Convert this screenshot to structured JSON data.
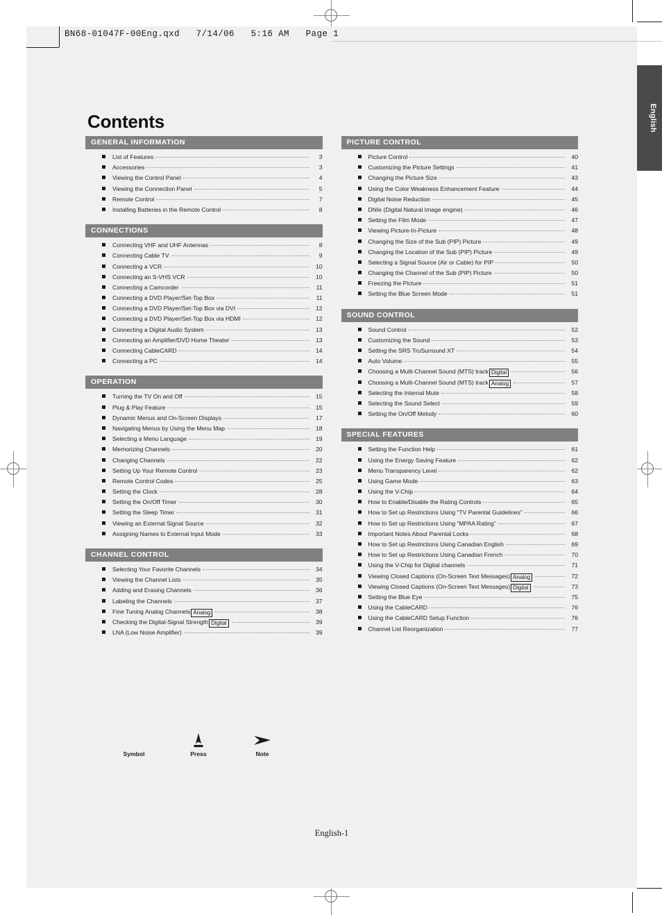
{
  "file_header": "BN68-01047F-00Eng.qxd   7/14/06   5:16 AM   Page 1",
  "lang_tab": "English",
  "page_title": "Contents",
  "footer": "English-1",
  "legend": {
    "symbol_label": "Symbol",
    "press_label": "Press",
    "note_label": "Note"
  },
  "columns": [
    {
      "sections": [
        {
          "header": "GENERAL INFORMATION",
          "items": [
            {
              "label": "List of Features",
              "page": "3"
            },
            {
              "label": "Accessories",
              "page": "3"
            },
            {
              "label": "Viewing the Control Panel",
              "page": "4"
            },
            {
              "label": "Viewing the Connection Panel",
              "page": "5"
            },
            {
              "label": "Remote Control",
              "page": "7"
            },
            {
              "label": "Installing Batteries in the Remote Control",
              "page": "8"
            }
          ]
        },
        {
          "header": "CONNECTIONS",
          "items": [
            {
              "label": "Connecting VHF and UHF Antennas",
              "page": "8"
            },
            {
              "label": "Connecting Cable TV",
              "page": "9"
            },
            {
              "label": "Connecting a VCR",
              "page": "10"
            },
            {
              "label": "Connecting an S-VHS VCR",
              "page": "10"
            },
            {
              "label": "Connecting a Camcorder",
              "page": "11"
            },
            {
              "label": "Connecting a DVD Player/Set-Top Box",
              "page": "11"
            },
            {
              "label": "Connecting a DVD Player/Set-Top Box via DVI",
              "page": "12"
            },
            {
              "label": "Connecting a DVD Player/Set-Top Box via HDMI",
              "page": "12"
            },
            {
              "label": "Connecting a Digital Audio System",
              "page": "13"
            },
            {
              "label": "Connecting an Amplifier/DVD Home Theater",
              "page": "13"
            },
            {
              "label": "Connecting CableCARD",
              "page": "14"
            },
            {
              "label": "Connecting a PC",
              "page": "14"
            }
          ]
        },
        {
          "header": "OPERATION",
          "items": [
            {
              "label": "Turning the TV On and Off",
              "page": "15"
            },
            {
              "label": "Plug & Play Feature",
              "page": "15"
            },
            {
              "label": "Dynamic Menus and On-Screen Displays",
              "page": "17"
            },
            {
              "label": "Navigating Menus by Using the Menu Map",
              "page": "18"
            },
            {
              "label": "Selecting a Menu Language",
              "page": "19"
            },
            {
              "label": "Memorizing Channels",
              "page": "20"
            },
            {
              "label": "Changing Channels",
              "page": "22"
            },
            {
              "label": "Setting Up Your Remote Control",
              "page": "23"
            },
            {
              "label": "Remote Control Codes",
              "page": "25"
            },
            {
              "label": "Setting the Clock",
              "page": "28"
            },
            {
              "label": "Setting the On/Off Timer",
              "page": "30"
            },
            {
              "label": "Setting the Sleep Timer",
              "page": "31"
            },
            {
              "label": "Viewing an External Signal Source",
              "page": "32"
            },
            {
              "label": "Assigning Names to External Input Mode",
              "page": "33"
            }
          ]
        },
        {
          "header": "CHANNEL CONTROL",
          "items": [
            {
              "label": "Selecting Your Favorite Channels",
              "page": "34"
            },
            {
              "label": "Viewing the Channel Lists",
              "page": "35"
            },
            {
              "label": "Adding and Erasing Channels",
              "page": "36"
            },
            {
              "label": "Labeling the Channels",
              "page": "37"
            },
            {
              "label": "Fine Tuning Analog Channels",
              "tag": "Analog",
              "page": "38"
            },
            {
              "label": "Checking the Digital-Signal Strength",
              "tag": "Digital",
              "page": "39"
            },
            {
              "label": "LNA (Low Noise Amplifier)",
              "page": "39"
            }
          ]
        }
      ]
    },
    {
      "sections": [
        {
          "header": "PICTURE CONTROL",
          "items": [
            {
              "label": "Picture Control",
              "page": "40"
            },
            {
              "label": "Customizing the Picture Settings",
              "page": "41"
            },
            {
              "label": "Changing the Picture Size",
              "page": "43"
            },
            {
              "label": "Using the Color Weakness Enhancement Feature",
              "page": "44"
            },
            {
              "label": "Digital Noise Reduction",
              "page": "45"
            },
            {
              "label": "DNIe (Digital Natural Image engine)",
              "page": "46"
            },
            {
              "label": "Setting the Film Mode",
              "page": "47"
            },
            {
              "label": "Viewing Picture-In-Picture",
              "page": "48"
            },
            {
              "label": "Changing the Size of the Sub (PIP) Picture",
              "page": "49"
            },
            {
              "label": "Changing the Location of the Sub (PIP) Picture",
              "page": "49"
            },
            {
              "label": "Selecting a Signal Source (Air or Cable) for PIP",
              "page": "50"
            },
            {
              "label": "Changing the Channel of the Sub (PIP) Picture",
              "page": "50"
            },
            {
              "label": "Freezing the Picture",
              "page": "51"
            },
            {
              "label": "Setting the Blue Screen Mode",
              "page": "51"
            }
          ]
        },
        {
          "header": "SOUND CONTROL",
          "items": [
            {
              "label": "Sound Control",
              "page": "52"
            },
            {
              "label": "Customizing the Sound",
              "page": "53"
            },
            {
              "label": "Setting the SRS TruSurround XT",
              "page": "54"
            },
            {
              "label": "Auto Volume",
              "page": "55"
            },
            {
              "label": "Choosing a Multi-Channel Sound (MTS) track",
              "tag": "Digital",
              "page": "56"
            },
            {
              "label": "Choosing a Multi-Channel Sound (MTS) track",
              "tag": "Analog",
              "page": "57"
            },
            {
              "label": "Selecting the Internal Mute",
              "page": "58"
            },
            {
              "label": "Selecting the Sound Select",
              "page": "59"
            },
            {
              "label": "Setting the On/Off Melody",
              "page": "60"
            }
          ]
        },
        {
          "header": "SPECIAL FEATURES",
          "items": [
            {
              "label": "Setting the Function Help",
              "page": "61"
            },
            {
              "label": "Using the Energy Saving Feature",
              "page": "62"
            },
            {
              "label": "Menu Transparency Level",
              "page": "62"
            },
            {
              "label": "Using Game Mode",
              "page": "63"
            },
            {
              "label": "Using the V-Chip",
              "page": "64"
            },
            {
              "label": "How to Enable/Disable the Rating Controls",
              "page": "65"
            },
            {
              "label": "How to Set up Restrictions Using “TV Parental Guidelines”",
              "page": "66"
            },
            {
              "label": "How to Set up Restrictions Using “MPAA Rating”",
              "page": "67"
            },
            {
              "label": "Important Notes About Parental Locks",
              "page": "68"
            },
            {
              "label": "How to Set up Restrictions Using Canadian English",
              "page": "69"
            },
            {
              "label": "How to Set up Restrictions Using Canadian French",
              "page": "70"
            },
            {
              "label": "Using the V-Chip for Digital channels",
              "page": "71"
            },
            {
              "label": "Viewing Closed Captions (On-Screen Text Messages)",
              "tag": "Analog",
              "page": "72"
            },
            {
              "label": "Viewing Closed Captions (On-Screen Text Messages)",
              "tag": "Digital",
              "page": "73"
            },
            {
              "label": "Setting the Blue Eye",
              "page": "75"
            },
            {
              "label": "Using the CableCARD",
              "page": "76"
            },
            {
              "label": "Using the CableCARD Setup Function",
              "page": "76"
            },
            {
              "label": "Channel List Reorganization",
              "page": "77"
            }
          ]
        }
      ]
    }
  ]
}
